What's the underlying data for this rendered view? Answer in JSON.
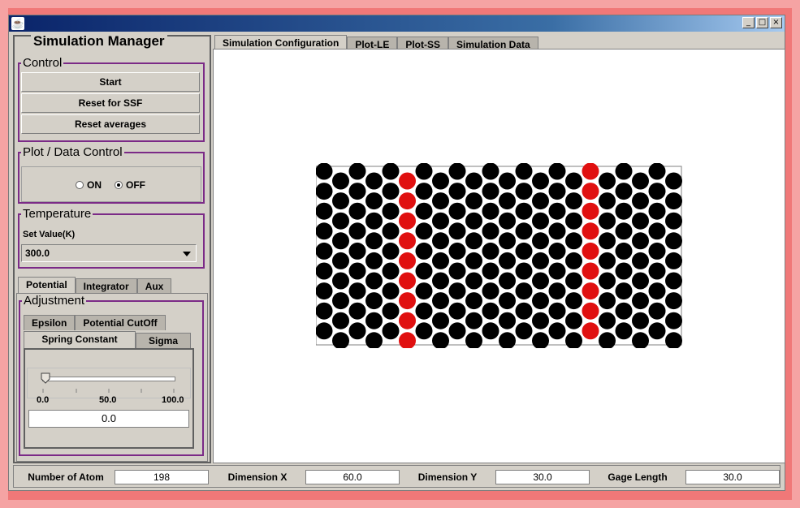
{
  "window": {
    "app_icon": "java-app-icon",
    "minimize": "_",
    "maximize": "□",
    "close": "×"
  },
  "left_panel": {
    "title": "Simulation Manager",
    "control": {
      "title": "Control",
      "buttons": [
        "Start",
        "Reset for SSF",
        "Reset averages"
      ]
    },
    "plot_data_control": {
      "title": "Plot / Data Control",
      "on_label": "ON",
      "off_label": "OFF",
      "selected": "OFF"
    },
    "temperature": {
      "title": "Temperature",
      "set_value_label": "Set Value(K)",
      "value": "300.0"
    },
    "tabs": [
      "Potential",
      "Integrator",
      "Aux"
    ],
    "active_tab": "Potential",
    "adjustment": {
      "title": "Adjustment",
      "subtabs_back": [
        "Epsilon",
        "Potential CutOff"
      ],
      "subtabs_front": [
        "Spring Constant",
        "Sigma"
      ],
      "active_subtab": "Spring Constant",
      "slider": {
        "min_label": "0.0",
        "mid_label": "50.0",
        "max_label": "100.0",
        "value": 0.0
      },
      "value_field": "0.0"
    }
  },
  "main": {
    "tabs": [
      "Simulation Configuration",
      "Plot-LE",
      "Plot-SS",
      "Simulation Data"
    ],
    "active_tab": "Simulation Configuration",
    "particles": {
      "columns": 22,
      "rows_per_column": 9,
      "red_columns": [
        5,
        16
      ],
      "colors": {
        "normal": "#000000",
        "highlight": "#e01010"
      }
    }
  },
  "status": {
    "number_of_atom_label": "Number of Atom",
    "number_of_atom_value": "198",
    "dimension_x_label": "Dimension X",
    "dimension_x_value": "60.0",
    "dimension_y_label": "Dimension Y",
    "dimension_y_value": "30.0",
    "gage_length_label": "Gage Length",
    "gage_length_value": "30.0"
  }
}
